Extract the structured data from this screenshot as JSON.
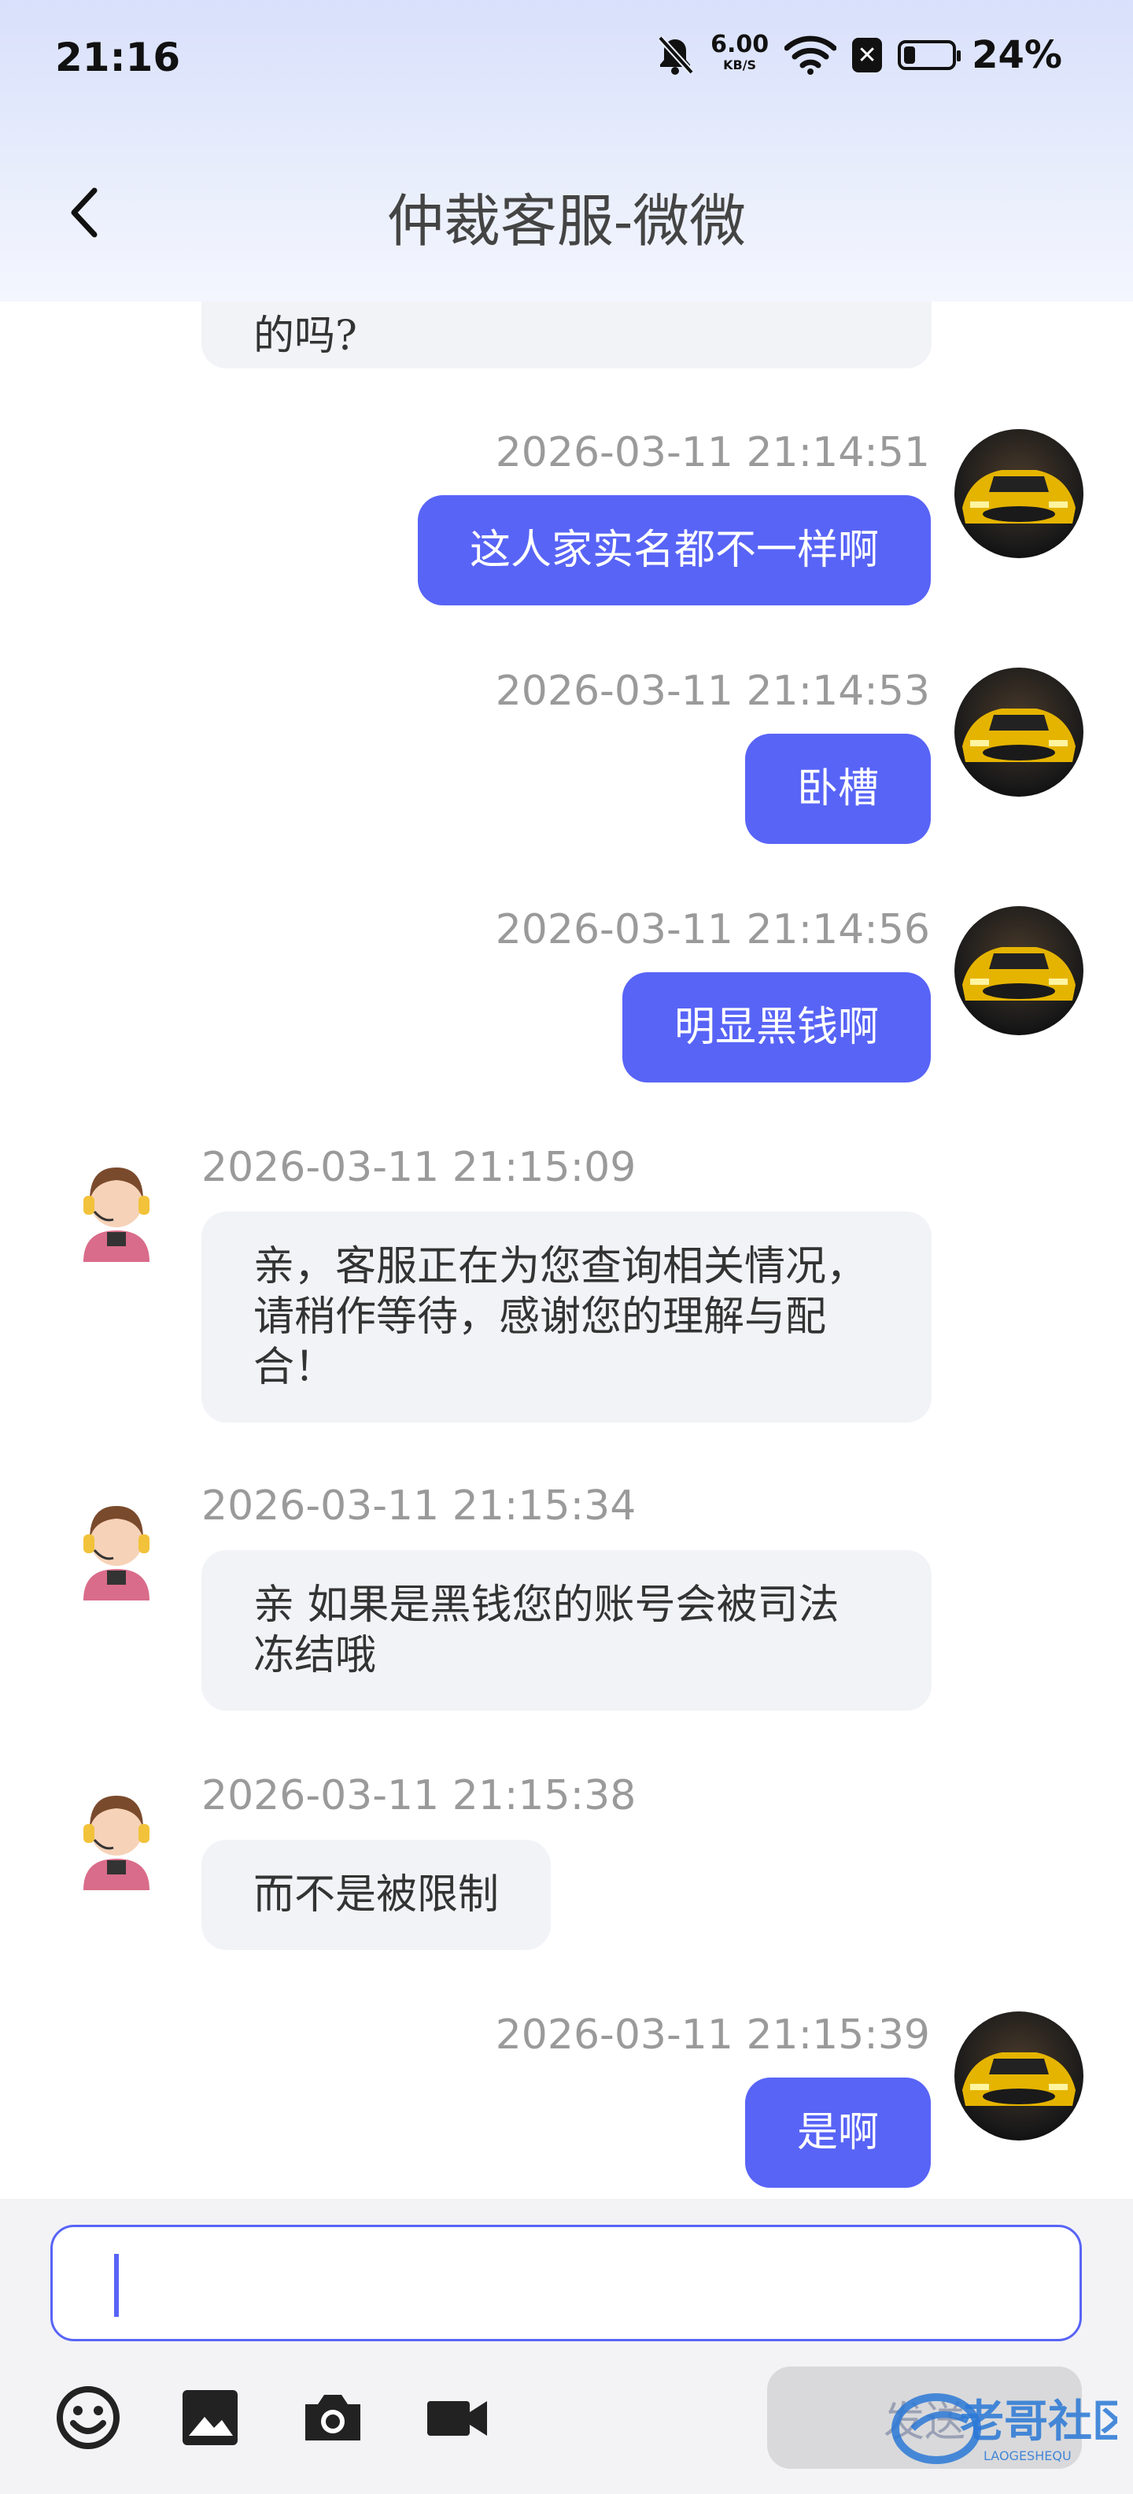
{
  "status_bar": {
    "time": "21:16",
    "net_speed": "6.00",
    "net_unit": "KB/S",
    "battery_percent": "24%",
    "battery_level": 0.24
  },
  "header": {
    "title": "仲裁客服-微微"
  },
  "messages": [
    {
      "direction": "in",
      "text": "的吗?"
    },
    {
      "direction": "out",
      "timestamp": "2026-03-11 21:14:51",
      "text": "这人家实名都不一样啊"
    },
    {
      "direction": "out",
      "timestamp": "2026-03-11 21:14:53",
      "text": "卧槽"
    },
    {
      "direction": "out",
      "timestamp": "2026-03-11 21:14:56",
      "text": "明显黑钱啊"
    },
    {
      "direction": "in",
      "timestamp": "2026-03-11 21:15:09",
      "text": "亲，客服正在为您查询相关情况，请稍作等待，感谢您的理解与配合！"
    },
    {
      "direction": "in",
      "timestamp": "2026-03-11 21:15:34",
      "text": "亲 如果是黑钱您的账号会被司法冻结哦"
    },
    {
      "direction": "in",
      "timestamp": "2026-03-11 21:15:38",
      "text": "而不是被限制"
    },
    {
      "direction": "out",
      "timestamp": "2026-03-11 21:15:39",
      "text": "是啊"
    }
  ],
  "composer": {
    "input_value": "",
    "send_label": "发送",
    "tools": [
      "emoji-icon",
      "image-icon",
      "camera-icon",
      "video-icon"
    ]
  },
  "watermark": {
    "text": "老哥社区",
    "subtext": "LAOGESHEQU"
  },
  "colors": {
    "accent": "#5864f6",
    "incoming_bubble": "#f2f3f7",
    "timestamp": "#9a9a9a"
  }
}
